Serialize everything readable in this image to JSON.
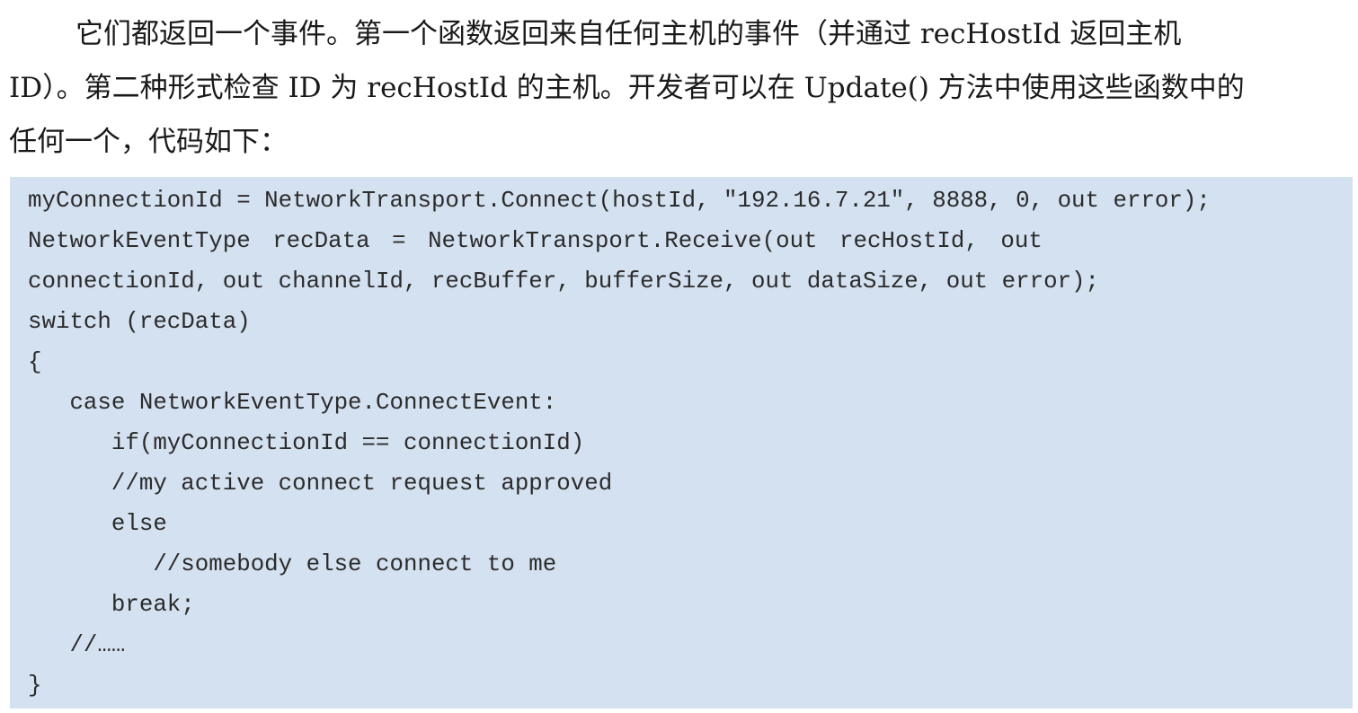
{
  "paragraph": {
    "lines": [
      "它们都返回一个事件。第一个函数返回来自任何主机的事件（并通过 recHostId 返回主机",
      "ID）。第二种形式检查 ID 为 recHostId 的主机。开发者可以在 Update() 方法中使用这些函数中的",
      "任何一个，代码如下："
    ]
  },
  "code": {
    "lines": [
      "myConnectionId = NetworkTransport.Connect(hostId, \"192.16.7.21\", 8888, 0, out error);",
      "NetworkEventType recData = NetworkTransport.Receive(out recHostId, out",
      "connectionId, out channelId, recBuffer, bufferSize, out dataSize, out error);",
      "switch (recData)",
      "{",
      "   case NetworkEventType.ConnectEvent:",
      "      if(myConnectionId == connectionId)",
      "      //my active connect request approved",
      "      else",
      "         //somebody else connect to me",
      "      break;",
      "   //……",
      "}"
    ]
  }
}
